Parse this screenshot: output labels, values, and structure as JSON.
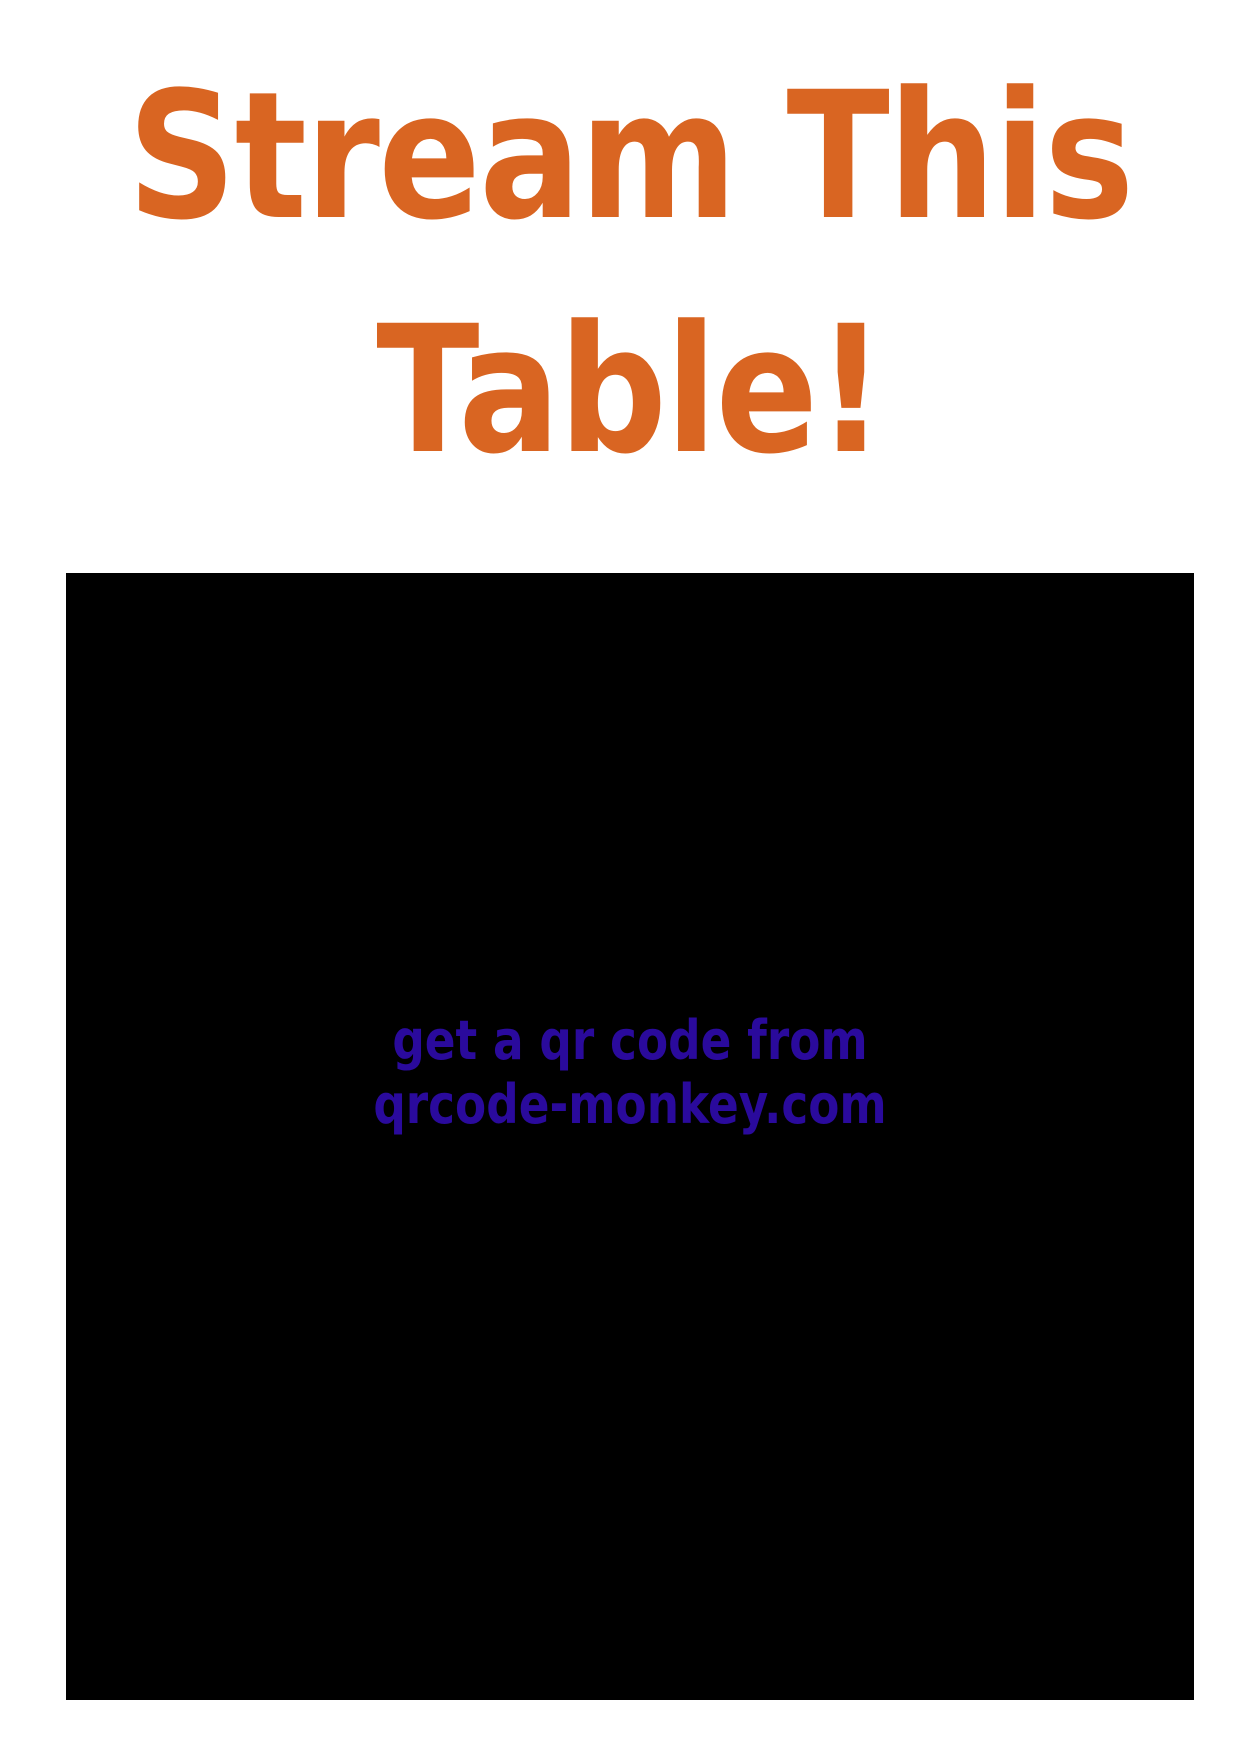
{
  "headline": {
    "line1": "Stream This",
    "line2": "Table!"
  },
  "qr_placeholder": {
    "line1": "get a qr code from",
    "line2": "qrcode-monkey.com"
  },
  "colors": {
    "headline": "#d96522",
    "placeholder_background": "#000000",
    "placeholder_text": "#2a0a9c",
    "page_background": "#ffffff"
  }
}
